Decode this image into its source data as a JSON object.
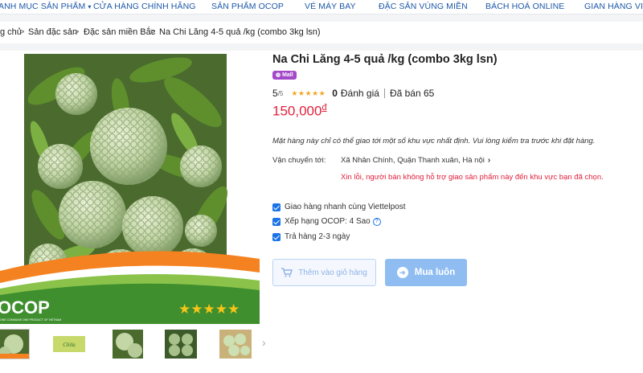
{
  "nav": {
    "items": [
      {
        "label": "ANH MỤC SẢN PHẨM",
        "caret": "▾"
      },
      {
        "label": "CỬA HÀNG CHÍNH HÃNG"
      },
      {
        "label": "SẢN PHẨM OCOP"
      },
      {
        "label": "VÉ MÁY BAY"
      },
      {
        "label": "ĐẶC SẢN VÙNG MIỀN"
      },
      {
        "label": "BÁCH HOÁ ONLINE"
      },
      {
        "label": "GIAN HÀNG VIỆT"
      }
    ]
  },
  "breadcrumb": {
    "items": [
      "g chủ",
      "Sản đặc sản",
      "Đặc sản miền Bắc",
      "Na Chi Lăng 4-5 quả /kg (combo 3kg lsn)"
    ],
    "separator": ">"
  },
  "product": {
    "title": "Na Chi Lăng 4-5 quả /kg (combo 3kg lsn)",
    "badge": "Mall",
    "badge_icon": "mall-bag-icon",
    "rating": "5",
    "rating_max": "/5",
    "stars": "★★★★★",
    "review_count": "0",
    "review_label": "Đánh giá",
    "sold_label": "Đã bán 65",
    "price": "150,000",
    "currency": "đ",
    "image_stars": "★★★★★",
    "image_brand": "OCOP",
    "image_brand_sub": "ONE COMMUNE ONE PRODUCT OF VIETNAM"
  },
  "shipping": {
    "notice": "Mặt hàng này chỉ có thể giao tới một số khu vực nhất định. Vui lòng kiểm tra trước khi đặt hàng.",
    "label": "Vận chuyển tới:",
    "address": "Xã Nhân Chính, Quận Thanh xuân, Hà nội",
    "address_chevron": "›",
    "error": "Xin lỗi, người bán không hỗ trợ giao sản phẩm này đến khu vực bạn đã chọn."
  },
  "features": [
    {
      "label": "Giao hàng nhanh cùng Viettelpost"
    },
    {
      "label": "Xếp hạng OCOP: 4 Sao",
      "has_help": true,
      "help": "?"
    },
    {
      "label": "Trả hàng 2-3 ngày"
    }
  ],
  "actions": {
    "add_to_cart": "Thêm vào giỏ hàng",
    "buy_now": "Mua luôn",
    "cart_icon": "cart-icon",
    "buy_icon": "arrow-right-circle-icon"
  },
  "gallery": {
    "next_arrow": "›"
  },
  "colors": {
    "nav_link": "#1d58a8",
    "price": "#e1203c",
    "mall_badge": "#a348c9",
    "check": "#1a73e8",
    "buy_button": "#8fbdf1"
  }
}
